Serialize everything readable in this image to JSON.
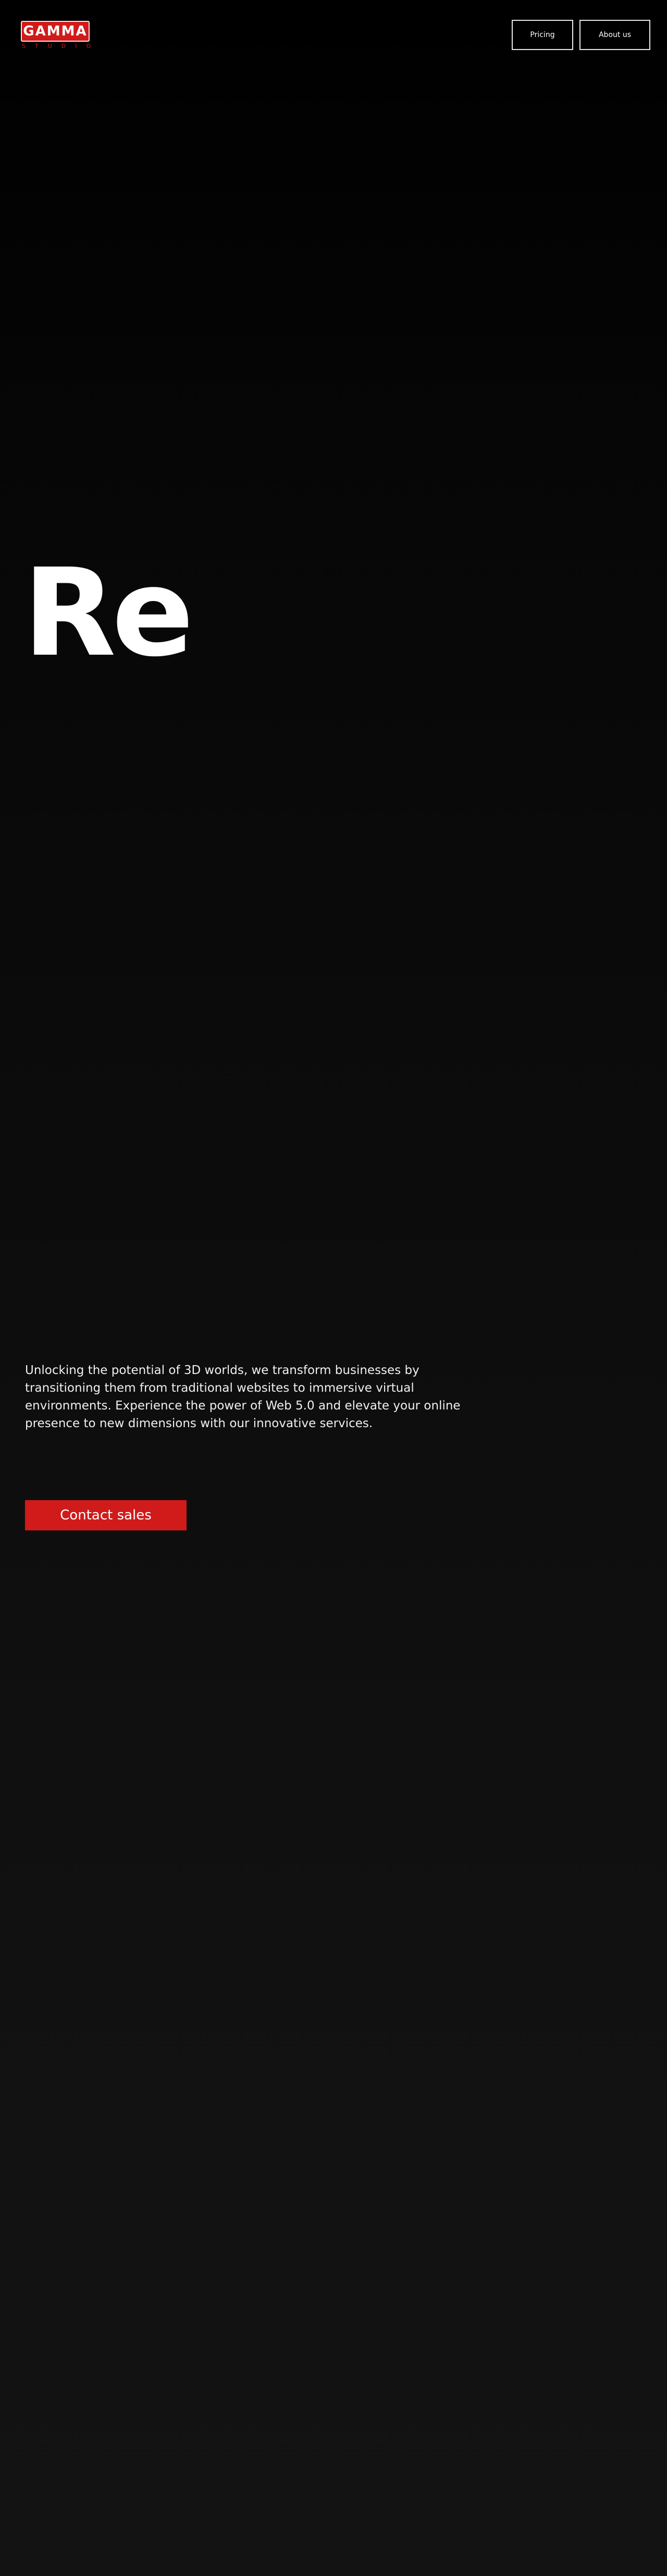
{
  "brand": {
    "logo_word": "GAMMA",
    "logo_subtitle": "STUDIO",
    "accent_color": "#d11a1a"
  },
  "nav": {
    "items": [
      {
        "label": "Pricing"
      },
      {
        "label": "About us"
      }
    ]
  },
  "hero": {
    "animated_word": "Re",
    "description": "Unlocking the potential of 3D worlds, we transform businesses by transitioning them from traditional websites to immersive virtual environments. Experience the power of Web 5.0 and elevate your online presence to new dimensions with our innovative services.",
    "cta_label": "Contact sales"
  }
}
